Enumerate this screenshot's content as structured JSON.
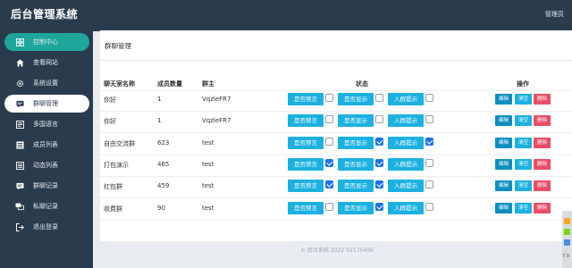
{
  "app": {
    "title": "后台管理系统",
    "version": "v175406",
    "admin_label": "管理员"
  },
  "sidebar": {
    "items": [
      {
        "label": "控制中心",
        "icon": "dashboard-icon"
      },
      {
        "label": "查看网站",
        "icon": "home-icon"
      },
      {
        "label": "系统设置",
        "icon": "gear-icon"
      },
      {
        "label": "群聊管理",
        "icon": "chat-icon"
      },
      {
        "label": "多国语言",
        "icon": "language-icon"
      },
      {
        "label": "成员列表",
        "icon": "members-icon"
      },
      {
        "label": "动态列表",
        "icon": "feed-icon"
      },
      {
        "label": "群聊记录",
        "icon": "chat-record-icon"
      },
      {
        "label": "私聊记录",
        "icon": "private-chat-icon"
      },
      {
        "label": "退出登录",
        "icon": "logout-icon"
      }
    ]
  },
  "page": {
    "title": "群聊管理"
  },
  "table": {
    "headers": [
      "聊天室名称",
      "成员数量",
      "群主",
      "状态",
      "操作"
    ],
    "status_buttons": [
      "是否禁言",
      "是否显示",
      "入群提示"
    ],
    "action_buttons": [
      "编辑",
      "清空",
      "删除"
    ],
    "rows": [
      {
        "name": "你好",
        "members": "1",
        "owner": "VqzleFR7",
        "mute": false,
        "show": false,
        "join_tip": false
      },
      {
        "name": "你好",
        "members": "1",
        "owner": "VqzleFR7",
        "mute": false,
        "show": false,
        "join_tip": false
      },
      {
        "name": "自由交流群",
        "members": "623",
        "owner": "test",
        "mute": false,
        "show": true,
        "join_tip": true
      },
      {
        "name": "打包演示",
        "members": "465",
        "owner": "test",
        "mute": true,
        "show": true,
        "join_tip": false
      },
      {
        "name": "红包群",
        "members": "459",
        "owner": "test",
        "mute": true,
        "show": true,
        "join_tip": false
      },
      {
        "name": "收费群",
        "members": "90",
        "owner": "test",
        "mute": false,
        "show": true,
        "join_tip": false
      }
    ]
  },
  "footer": {
    "text": "© 后台系统 2022 V2175406"
  },
  "edge": {
    "text": "7.9"
  },
  "colors": {
    "sidebar_bg": "#2b3b4e",
    "active_bg": "#1fa69a",
    "status_button": "#1cb1e0",
    "edit_button": "#0e8fbf",
    "delete_button": "#e94e66"
  }
}
